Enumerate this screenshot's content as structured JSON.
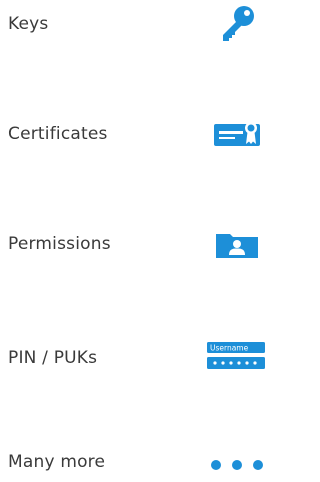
{
  "accent_color": "#1d8fd8",
  "items": [
    {
      "label": "Keys",
      "icon": "key-icon"
    },
    {
      "label": "Certificates",
      "icon": "certificate-icon"
    },
    {
      "label": "Permissions",
      "icon": "permissions-folder-icon"
    },
    {
      "label": "PIN / PUKs",
      "icon": "pin-puk-field-icon",
      "icon_text": "Username"
    },
    {
      "label": "Many more",
      "icon": "more-dots-icon"
    }
  ]
}
